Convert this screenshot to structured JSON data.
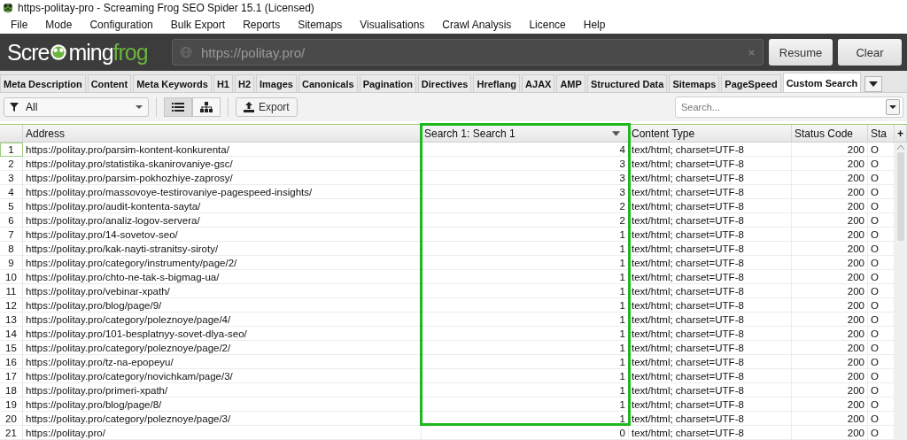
{
  "window": {
    "title": "https-politay-pro - Screaming Frog SEO Spider 15.1 (Licensed)"
  },
  "menu": [
    "File",
    "Mode",
    "Configuration",
    "Bulk Export",
    "Reports",
    "Sitemaps",
    "Visualisations",
    "Crawl Analysis",
    "Licence",
    "Help"
  ],
  "header": {
    "logo_start": "Scre",
    "logo_mid": "ming",
    "logo_end": "frog",
    "url": "https://politay.pro/",
    "buttons": [
      "Resume",
      "Clear"
    ]
  },
  "tabs": [
    {
      "label": "Meta Description",
      "selected": false
    },
    {
      "label": "Content",
      "selected": false
    },
    {
      "label": "Meta Keywords",
      "selected": false
    },
    {
      "label": "H1",
      "selected": false
    },
    {
      "label": "H2",
      "selected": false
    },
    {
      "label": "Images",
      "selected": false
    },
    {
      "label": "Canonicals",
      "selected": false
    },
    {
      "label": "Pagination",
      "selected": false
    },
    {
      "label": "Directives",
      "selected": false
    },
    {
      "label": "Hreflang",
      "selected": false
    },
    {
      "label": "AJAX",
      "selected": false
    },
    {
      "label": "AMP",
      "selected": false
    },
    {
      "label": "Structured Data",
      "selected": false
    },
    {
      "label": "Sitemaps",
      "selected": false
    },
    {
      "label": "PageSpeed",
      "selected": false
    },
    {
      "label": "Custom Search",
      "selected": true
    }
  ],
  "toolbar": {
    "filter": "All",
    "view_modes": [
      {
        "kind": "list",
        "selected": true
      },
      {
        "kind": "tree",
        "selected": false
      }
    ],
    "export": "Export",
    "search": {
      "placeholder": "Search..."
    }
  },
  "table": {
    "columns": [
      {
        "label": "Address",
        "highlighted": false
      },
      {
        "label": "Search 1: Search 1",
        "highlighted": true
      },
      {
        "label": "Content Type",
        "highlighted": false
      },
      {
        "label": "Status Code",
        "highlighted": false
      },
      {
        "label": "Sta",
        "highlighted": false
      }
    ],
    "rows": [
      {
        "n": "1",
        "cells": [
          "https://politay.pro/parsim-kontent-konkurenta/",
          "4",
          "text/html; charset=UTF-8",
          "200",
          "O"
        ],
        "selected": true
      },
      {
        "n": "2",
        "cells": [
          "https://politay.pro/statistika-skanirovaniye-gsc/",
          "3",
          "text/html; charset=UTF-8",
          "200",
          "O"
        ],
        "selected": false
      },
      {
        "n": "3",
        "cells": [
          "https://politay.pro/parsim-pokhozhiye-zaprosy/",
          "3",
          "text/html; charset=UTF-8",
          "200",
          "O"
        ],
        "selected": false
      },
      {
        "n": "4",
        "cells": [
          "https://politay.pro/massovoye-testirovaniye-pagespeed-insights/",
          "3",
          "text/html; charset=UTF-8",
          "200",
          "O"
        ],
        "selected": false
      },
      {
        "n": "5",
        "cells": [
          "https://politay.pro/audit-kontenta-sayta/",
          "2",
          "text/html; charset=UTF-8",
          "200",
          "O"
        ],
        "selected": false
      },
      {
        "n": "6",
        "cells": [
          "https://politay.pro/analiz-logov-servera/",
          "2",
          "text/html; charset=UTF-8",
          "200",
          "O"
        ],
        "selected": false
      },
      {
        "n": "7",
        "cells": [
          "https://politay.pro/14-sovetov-seo/",
          "1",
          "text/html; charset=UTF-8",
          "200",
          "O"
        ],
        "selected": false
      },
      {
        "n": "8",
        "cells": [
          "https://politay.pro/kak-nayti-stranitsy-siroty/",
          "1",
          "text/html; charset=UTF-8",
          "200",
          "O"
        ],
        "selected": false
      },
      {
        "n": "9",
        "cells": [
          "https://politay.pro/category/instrumenty/page/2/",
          "1",
          "text/html; charset=UTF-8",
          "200",
          "O"
        ],
        "selected": false
      },
      {
        "n": "10",
        "cells": [
          "https://politay.pro/chto-ne-tak-s-bigmag-ua/",
          "1",
          "text/html; charset=UTF-8",
          "200",
          "O"
        ],
        "selected": false
      },
      {
        "n": "11",
        "cells": [
          "https://politay.pro/vebinar-xpath/",
          "1",
          "text/html; charset=UTF-8",
          "200",
          "O"
        ],
        "selected": false
      },
      {
        "n": "12",
        "cells": [
          "https://politay.pro/blog/page/9/",
          "1",
          "text/html; charset=UTF-8",
          "200",
          "O"
        ],
        "selected": false
      },
      {
        "n": "13",
        "cells": [
          "https://politay.pro/category/poleznoye/page/4/",
          "1",
          "text/html; charset=UTF-8",
          "200",
          "O"
        ],
        "selected": false
      },
      {
        "n": "14",
        "cells": [
          "https://politay.pro/101-besplatnyy-sovet-dlya-seo/",
          "1",
          "text/html; charset=UTF-8",
          "200",
          "O"
        ],
        "selected": false
      },
      {
        "n": "15",
        "cells": [
          "https://politay.pro/category/poleznoye/page/2/",
          "1",
          "text/html; charset=UTF-8",
          "200",
          "O"
        ],
        "selected": false
      },
      {
        "n": "16",
        "cells": [
          "https://politay.pro/tz-na-epopeyu/",
          "1",
          "text/html; charset=UTF-8",
          "200",
          "O"
        ],
        "selected": false
      },
      {
        "n": "17",
        "cells": [
          "https://politay.pro/category/novichkam/page/3/",
          "1",
          "text/html; charset=UTF-8",
          "200",
          "O"
        ],
        "selected": false
      },
      {
        "n": "18",
        "cells": [
          "https://politay.pro/primeri-xpath/",
          "1",
          "text/html; charset=UTF-8",
          "200",
          "O"
        ],
        "selected": false
      },
      {
        "n": "19",
        "cells": [
          "https://politay.pro/blog/page/8/",
          "1",
          "text/html; charset=UTF-8",
          "200",
          "O"
        ],
        "selected": false
      },
      {
        "n": "20",
        "cells": [
          "https://politay.pro/category/poleznoye/page/3/",
          "1",
          "text/html; charset=UTF-8",
          "200",
          "O"
        ],
        "selected": false
      },
      {
        "n": "21",
        "cells": [
          "https://politay.pro/",
          "0",
          "text/html; charset=UTF-8",
          "200",
          "O"
        ],
        "selected": false
      }
    ],
    "add_column": "+"
  }
}
